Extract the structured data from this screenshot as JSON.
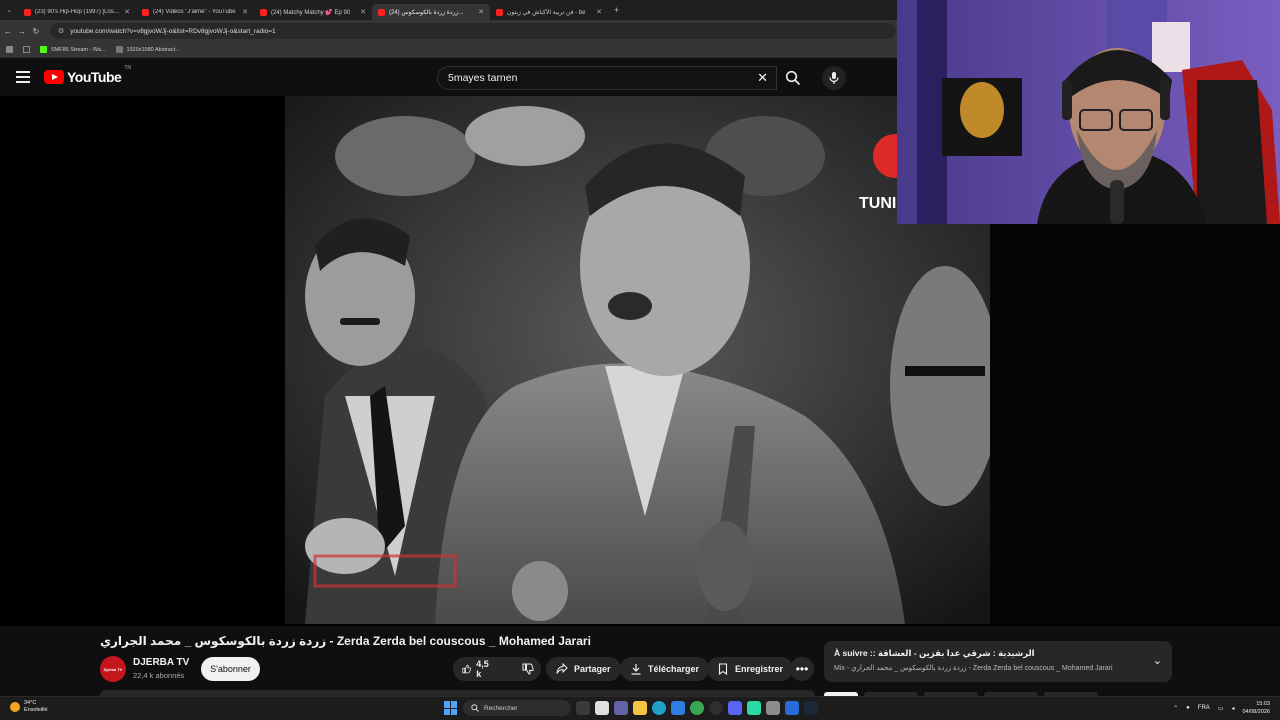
{
  "browser": {
    "tabs": [
      {
        "title": "(23) 90's Hip-Hop (1997) [Lost ...",
        "active": false
      },
      {
        "title": "(24) Vidéos \"J'aime\" - YouTube",
        "active": false
      },
      {
        "title": "(24) Matchy Matchy 💕 Ep 90",
        "active": false
      },
      {
        "title": "(24) زردة زردة بالكوسكوس...",
        "active": true
      },
      {
        "title": "فن تربية الأكباش في زيتون - be",
        "active": false
      }
    ],
    "url": "youtube.com/watch?v=v8gjvoWJj-o&list=RDv8gjvoWJj-o&start_radio=1",
    "bookmarks": [
      "SMF86 Stream - Wa...",
      "1920x1080 Abstract..."
    ]
  },
  "youtube": {
    "logo_text": "YouTube",
    "logo_country": "TN",
    "search_value": "5mayes tarnen",
    "video_title": "زردة زردة بالكوسكوس _ محمد الجراري - Zerda Zerda bel couscous _ Mohamed Jarari",
    "channel_name": "DJERBA TV",
    "channel_subs": "22,4 k abonnés",
    "channel_avatar_text": "Djerba TV",
    "subscribe_label": "S'abonner",
    "like_count": "4,5 k",
    "share_label": "Partager",
    "download_label": "Télécharger",
    "save_label": "Enregistrer",
    "up_next_title": "À suivre :: الرشيدية : شرقي عدا بقزين - العشاقة",
    "up_next_sub": "Mix - زردة زردة بالكوسكوس _ محمد الجراري - Zerda Zerda bel couscous _ Mohamed Jarari",
    "watermark_text": "TUNI"
  },
  "taskbar": {
    "temperature": "34°C",
    "weather_text": "Ensoleillé",
    "search_placeholder": "Rechercher",
    "language": "FRA",
    "time": "15:03",
    "date": "04/08/2026"
  },
  "colors": {
    "yt_red": "#ff0000",
    "background": "#0f0f0f",
    "pill": "#272727"
  }
}
